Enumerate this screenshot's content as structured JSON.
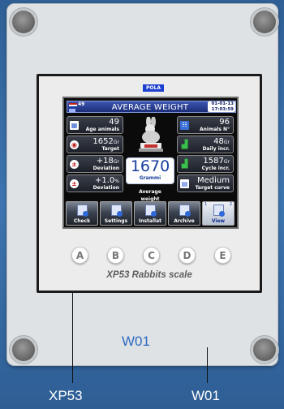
{
  "brand": "POLA",
  "header": {
    "counter": "49",
    "title": "AVERAGE WEIGHT",
    "date": "01-01-13",
    "time": "17:03:59"
  },
  "tiles_left": [
    {
      "icon": "calendar-icon",
      "value": "49",
      "unit": "",
      "label": "Age animals"
    },
    {
      "icon": "target-icon",
      "value": "1652",
      "unit": "Gr",
      "label": "Target"
    },
    {
      "icon": "deviation-icon",
      "value": "+18",
      "unit": "Gr",
      "label": "Deviation"
    },
    {
      "icon": "deviation-percent-icon",
      "value": "+1.0",
      "unit": "%",
      "label": "Deviation"
    }
  ],
  "tiles_right": [
    {
      "icon": "animals-count-icon",
      "value": "96",
      "unit": "",
      "label": "Animals N°"
    },
    {
      "icon": "growth-chart-icon",
      "value": "48",
      "unit": "Gr",
      "label": "Daily incr."
    },
    {
      "icon": "growth-chart-icon",
      "value": "1587",
      "unit": "Gr",
      "label": "Cycle incr."
    },
    {
      "icon": "curve-icon",
      "value": "Medium",
      "unit": "",
      "label": "Target curve"
    }
  ],
  "center": {
    "weight": "1670",
    "unit": "Grammi",
    "label_line1": "Average",
    "label_line2": "weight"
  },
  "toolbar": [
    {
      "label": "Check",
      "num": "",
      "selected": false
    },
    {
      "label": "Settings",
      "num": "",
      "selected": false
    },
    {
      "label": "Installat",
      "num": "",
      "selected": false
    },
    {
      "label": "Archive",
      "num": "",
      "selected": false
    },
    {
      "label": "View",
      "num_left": "1",
      "num_right": "2",
      "selected": true
    }
  ],
  "keys": [
    "A",
    "B",
    "C",
    "D",
    "E"
  ],
  "model": "XP53 Rabbits scale",
  "panel_code": "W01",
  "callouts": {
    "left": "XP53",
    "right": "W01"
  },
  "colors": {
    "background": "#3d75b0",
    "panel": "#dfe2e5",
    "lcd_accent": "#1a3e9f",
    "panel_text": "#2c6ac0"
  }
}
